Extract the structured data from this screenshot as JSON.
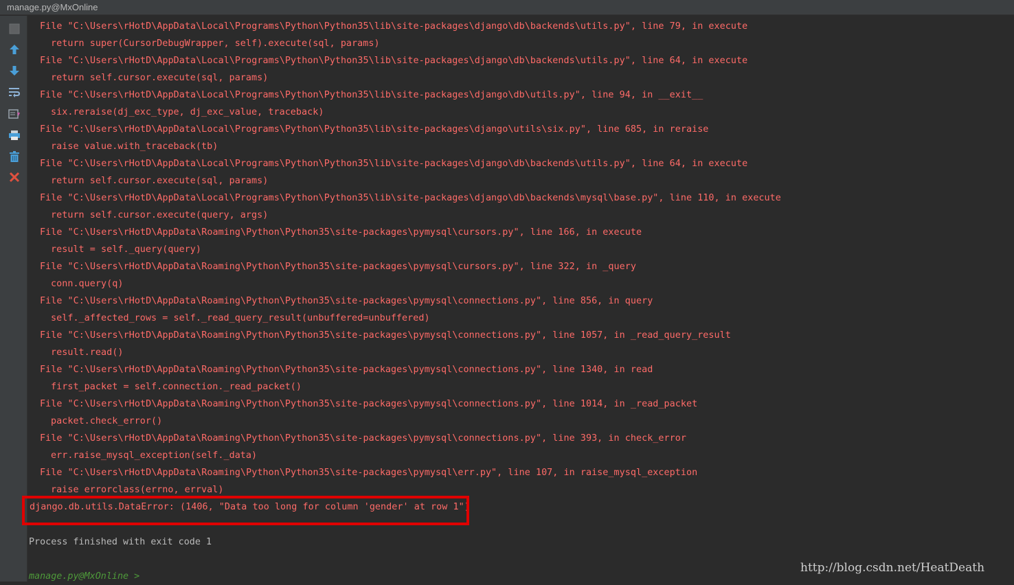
{
  "window": {
    "title": "manage.py@MxOnline"
  },
  "toolbar": {
    "icons": [
      "stop-icon",
      "arrow-up-icon",
      "arrow-down-icon",
      "soft-wrap-icon",
      "scroll-to-end-icon",
      "print-icon",
      "trash-icon",
      "close-icon"
    ]
  },
  "console": {
    "traceback": [
      {
        "file": "File \"C:\\Users\\rHotD\\AppData\\Local\\Programs\\Python\\Python35\\lib\\site-packages\\django\\db\\backends\\utils.py\", line 79, in execute",
        "code": "return super(CursorDebugWrapper, self).execute(sql, params)"
      },
      {
        "file": "File \"C:\\Users\\rHotD\\AppData\\Local\\Programs\\Python\\Python35\\lib\\site-packages\\django\\db\\backends\\utils.py\", line 64, in execute",
        "code": "return self.cursor.execute(sql, params)"
      },
      {
        "file": "File \"C:\\Users\\rHotD\\AppData\\Local\\Programs\\Python\\Python35\\lib\\site-packages\\django\\db\\utils.py\", line 94, in __exit__",
        "code": "six.reraise(dj_exc_type, dj_exc_value, traceback)"
      },
      {
        "file": "File \"C:\\Users\\rHotD\\AppData\\Local\\Programs\\Python\\Python35\\lib\\site-packages\\django\\utils\\six.py\", line 685, in reraise",
        "code": "raise value.with_traceback(tb)"
      },
      {
        "file": "File \"C:\\Users\\rHotD\\AppData\\Local\\Programs\\Python\\Python35\\lib\\site-packages\\django\\db\\backends\\utils.py\", line 64, in execute",
        "code": "return self.cursor.execute(sql, params)"
      },
      {
        "file": "File \"C:\\Users\\rHotD\\AppData\\Local\\Programs\\Python\\Python35\\lib\\site-packages\\django\\db\\backends\\mysql\\base.py\", line 110, in execute",
        "code": "return self.cursor.execute(query, args)"
      },
      {
        "file": "File \"C:\\Users\\rHotD\\AppData\\Roaming\\Python\\Python35\\site-packages\\pymysql\\cursors.py\", line 166, in execute",
        "code": "result = self._query(query)"
      },
      {
        "file": "File \"C:\\Users\\rHotD\\AppData\\Roaming\\Python\\Python35\\site-packages\\pymysql\\cursors.py\", line 322, in _query",
        "code": "conn.query(q)"
      },
      {
        "file": "File \"C:\\Users\\rHotD\\AppData\\Roaming\\Python\\Python35\\site-packages\\pymysql\\connections.py\", line 856, in query",
        "code": "self._affected_rows = self._read_query_result(unbuffered=unbuffered)"
      },
      {
        "file": "File \"C:\\Users\\rHotD\\AppData\\Roaming\\Python\\Python35\\site-packages\\pymysql\\connections.py\", line 1057, in _read_query_result",
        "code": "result.read()"
      },
      {
        "file": "File \"C:\\Users\\rHotD\\AppData\\Roaming\\Python\\Python35\\site-packages\\pymysql\\connections.py\", line 1340, in read",
        "code": "first_packet = self.connection._read_packet()"
      },
      {
        "file": "File \"C:\\Users\\rHotD\\AppData\\Roaming\\Python\\Python35\\site-packages\\pymysql\\connections.py\", line 1014, in _read_packet",
        "code": "packet.check_error()"
      },
      {
        "file": "File \"C:\\Users\\rHotD\\AppData\\Roaming\\Python\\Python35\\site-packages\\pymysql\\connections.py\", line 393, in check_error",
        "code": "err.raise_mysql_exception(self._data)"
      },
      {
        "file": "File \"C:\\Users\\rHotD\\AppData\\Roaming\\Python\\Python35\\site-packages\\pymysql\\err.py\", line 107, in raise_mysql_exception",
        "code": "raise errorclass(errno, errval)"
      }
    ],
    "error": "django.db.utils.DataError: (1406, \"Data too long for column 'gender' at row 1\")",
    "process": "Process finished with exit code 1",
    "prompt": "manage.py@MxOnline > "
  },
  "watermark": "http://blog.csdn.net/HeatDeath",
  "colors": {
    "background": "#2b2b2b",
    "error_text": "#ff6b68",
    "normal_text": "#bbbbbb",
    "prompt_text": "#4e9a3a",
    "highlight_border": "#e00000"
  }
}
